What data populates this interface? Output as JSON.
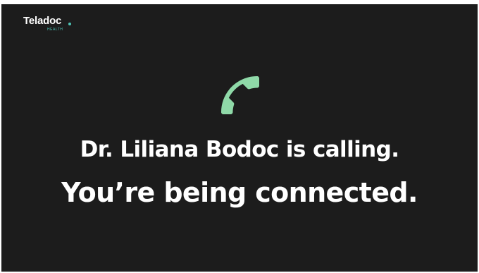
{
  "brand": {
    "name": "Teladoc",
    "subtitle": "HEALTH",
    "accent_color": "#4dc3b5"
  },
  "call": {
    "icon": "phone-icon",
    "icon_color": "#8fd9a8",
    "caller_line": "Dr. Liliana Bodoc is calling.",
    "status_line": "You’re being connected."
  },
  "colors": {
    "background": "#1c1c1c",
    "text": "#ffffff"
  }
}
